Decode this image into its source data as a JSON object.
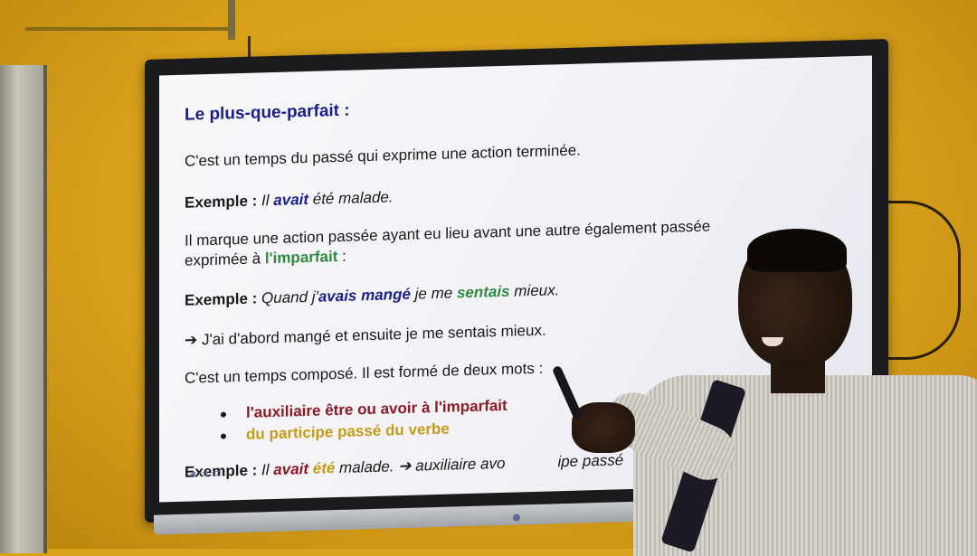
{
  "slide": {
    "title": "Le plus-que-parfait :",
    "definition": "C'est un temps du passé qui exprime une action terminée.",
    "example1": {
      "label": "Exemple : ",
      "il": "Il ",
      "avait": "avait",
      "ete": " été ",
      "malade": "malade."
    },
    "usage_line1": "Il marque une action passée ayant eu lieu avant une autre également passée",
    "usage_line2_a": "exprimée à ",
    "usage_line2_b": "l'imparfait",
    "usage_line2_c": " :",
    "example2": {
      "label": "Exemple : ",
      "quand": "Quand j'",
      "avais_mange": "avais mangé",
      "je_me": " je me ",
      "sentais": "sentais",
      "mieux": " mieux."
    },
    "arrow_line": "➔ J'ai d'abord mangé et ensuite je me sentais mieux.",
    "composed": "C'est un temps composé. Il est formé de deux mots :",
    "bullets": [
      "l'auxiliaire être ou avoir à l'imparfait",
      "du participe passé du verbe"
    ],
    "example3": {
      "label": "Exemple : ",
      "il": "Il ",
      "avait": "avait",
      "ete": " été",
      "malade": " malade. ",
      "arrow": "➔ auxiliaire avo",
      "rest": "ipe passé"
    }
  },
  "colors": {
    "wall": "#d9a21a",
    "title": "#1c1f8a",
    "green": "#2e8b3d",
    "red": "#8a1a22",
    "gold": "#c49a16"
  }
}
